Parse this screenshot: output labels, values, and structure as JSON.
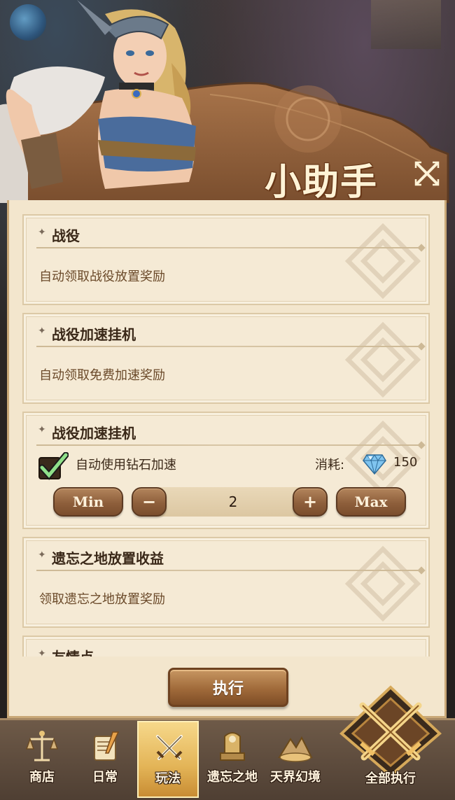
{
  "panel": {
    "title": "小助手",
    "close_icon": "close-icon"
  },
  "cards": [
    {
      "title": "战役",
      "desc": "自动领取战役放置奖励"
    },
    {
      "title": "战役加速挂机",
      "desc": "自动领取免费加速奖励"
    },
    {
      "title": "战役加速挂机",
      "auto_diamond_label": "自动使用钻石加速",
      "auto_diamond_checked": true,
      "cost_label": "消耗:",
      "cost_icon": "diamond-icon",
      "cost_value": "150",
      "min_label": "Min",
      "minus_label": "−",
      "quantity": "2",
      "plus_label": "+",
      "max_label": "Max"
    },
    {
      "title": "遗忘之地放置收益",
      "desc": "领取遗忘之地放置奖励"
    },
    {
      "title": "友情点"
    }
  ],
  "execute_label": "执行",
  "bottom_nav": {
    "items": [
      {
        "label": "商店",
        "icon": "scales-icon"
      },
      {
        "label": "日常",
        "icon": "scroll-quill-icon"
      },
      {
        "label": "玩法",
        "icon": "crossed-swords-icon",
        "active": true
      },
      {
        "label": "遗忘之地",
        "icon": "throne-icon"
      },
      {
        "label": "天界幻境",
        "icon": "mountain-icon"
      }
    ],
    "run_all_label": "全部执行",
    "run_all_icon": "crossed-swords-emblem-icon"
  },
  "colors": {
    "panel_bg": "#f3e6cd",
    "button_brown": "#8e5f3b",
    "title_text": "#fff3d6",
    "accent_gold": "#e3b457"
  }
}
